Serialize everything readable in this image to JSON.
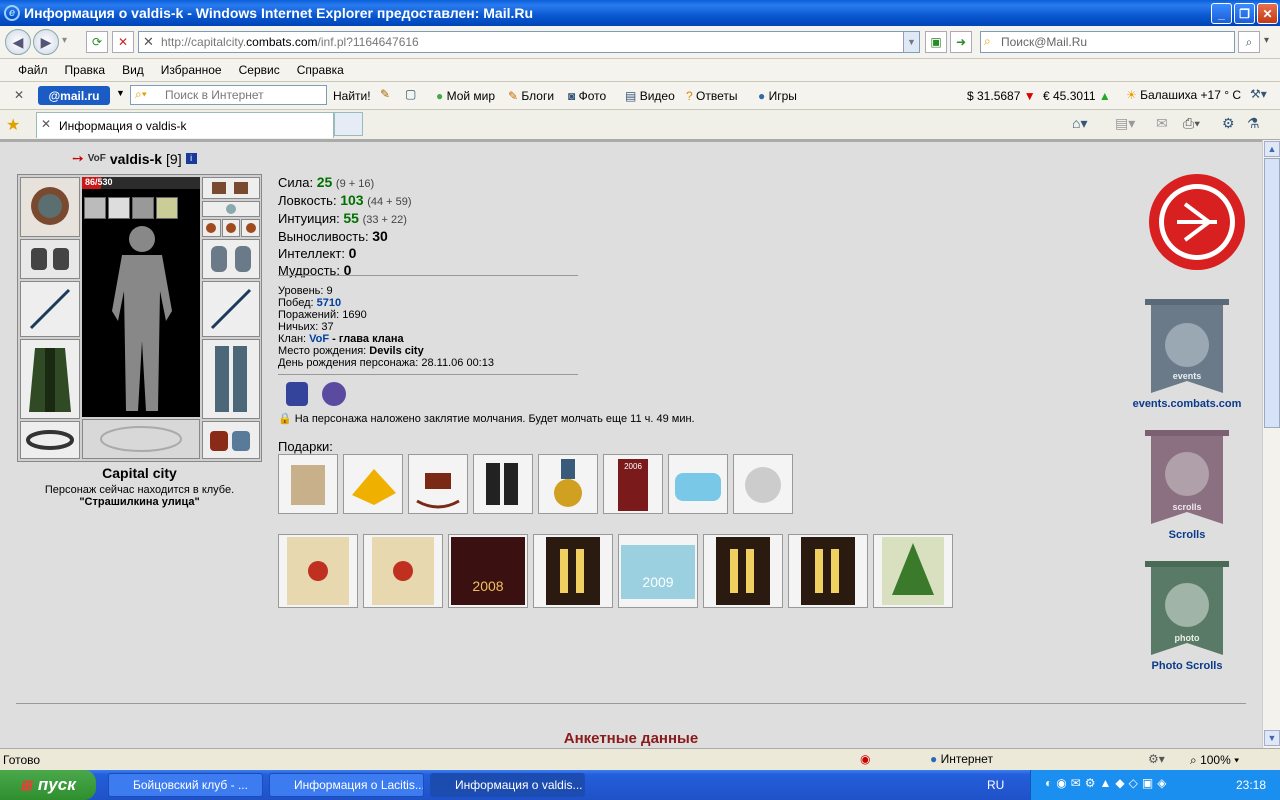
{
  "window": {
    "title": "Информация о valdis-k - Windows Internet Explorer предоставлен: Mail.Ru"
  },
  "address": {
    "prefix": "http://capitalcity.",
    "domain": "combats.com",
    "suffix": "/inf.pl?1164647616"
  },
  "search": {
    "placeholder": "Поиск@Mail.Ru"
  },
  "menu": [
    "Файл",
    "Правка",
    "Вид",
    "Избранное",
    "Сервис",
    "Справка"
  ],
  "toolbar": {
    "logo": "@mail.ru",
    "search_placeholder": "Поиск в Интернет",
    "find": "Найти!",
    "links": [
      "Мой мир",
      "Блоги",
      "Фото",
      "Видео",
      "Ответы",
      "Игры"
    ],
    "usd": "$ 31.5687",
    "eur": "€ 45.3011",
    "weather": "Балашиха +17 ° С"
  },
  "tab": {
    "label": "Информация о valdis-k"
  },
  "character": {
    "clan_tag": "VoF",
    "name": "valdis-k",
    "level": "[9]",
    "hp": "86/530",
    "city": "Capital city",
    "location_text": "Персонаж сейчас находится в клубе.",
    "location_place": "\"Страшилкина улица\""
  },
  "stats": [
    {
      "label": "Сила:",
      "value": "25",
      "detail": "(9 + 16)"
    },
    {
      "label": "Ловкость:",
      "value": "103",
      "detail": "(44 + 59)"
    },
    {
      "label": "Интуиция:",
      "value": "55",
      "detail": "(33 + 22)"
    },
    {
      "label": "Выносливость:",
      "value": "30",
      "detail": ""
    },
    {
      "label": "Интеллект:",
      "value": "0",
      "detail": ""
    },
    {
      "label": "Мудрость:",
      "value": "0",
      "detail": ""
    }
  ],
  "info": {
    "level_label": "Уровень:",
    "level_value": "9",
    "wins_label": "Побед:",
    "wins_value": "5710",
    "losses_label": "Поражений:",
    "losses_value": "1690",
    "draws_label": "Ничьих:",
    "draws_value": "37",
    "clan_label": "Клан:",
    "clan_value": "VoF",
    "clan_role": "- глава клана",
    "birthplace_label": "Место рождения:",
    "birthplace_value": "Devils city",
    "birthday_label": "День рождения персонажа:",
    "birthday_value": "28.11.06 00:13"
  },
  "silence": "На персонажа наложено заклятие молчания. Будет молчать еще 11 ч. 49 мин.",
  "gifts_label": "Подарки:",
  "gifts": [
    "mail-bag",
    "cheese",
    "rocking-horse",
    "boots",
    "medal",
    "calendar-2006",
    "ice-box",
    "cow"
  ],
  "cards": [
    "card-1",
    "card-2",
    "card-2008",
    "card-champagne",
    "card-2009",
    "card-champagne",
    "card-champagne",
    "card-tree"
  ],
  "calendar_year": "2006",
  "card_years": {
    "c3": "2008",
    "c5": "2009"
  },
  "side": {
    "events": "events.combats.com",
    "events_word": "events",
    "scrolls": "Scrolls",
    "scrolls_word": "scrolls",
    "photo": "Photo Scrolls",
    "photo_word": "photo"
  },
  "section_title": "Анкетные данные",
  "status": {
    "ready": "Готово",
    "zone": "Интернет",
    "zoom": "100%"
  },
  "taskbar": {
    "start": "пуск",
    "tasks": [
      "Бойцовский клуб - ...",
      "Информация о Lacitis...",
      "Информация о valdis..."
    ],
    "lang": "RU",
    "time": "23:18"
  },
  "colors": {
    "accent_green": "#007000",
    "clan_blue": "#0040a0",
    "title_red": "#8b1a1a"
  }
}
